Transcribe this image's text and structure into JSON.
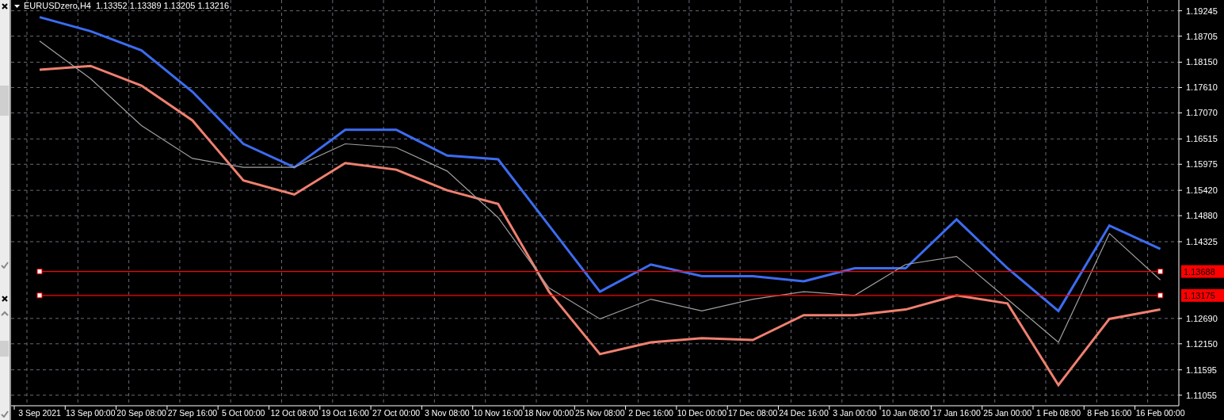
{
  "chart": {
    "ohlc": [
      "1.13352",
      "1.13389",
      "1.13205",
      "1.13216"
    ],
    "price_tags": [
      "1.13688",
      "1.13175"
    ],
    "chart_data": {
      "type": "line",
      "title": "EURUSDzero,H4",
      "grid": true,
      "categories": [
        "3 Sep 2021",
        "13 Sep 00:00",
        "20 Sep 08:00",
        "27 Sep 16:00",
        "5 Oct 00:00",
        "12 Oct 08:00",
        "19 Oct 16:00",
        "27 Oct 00:00",
        "3 Nov 08:00",
        "10 Nov 16:00",
        "18 Nov 00:00",
        "25 Nov 08:00",
        "2 Dec 16:00",
        "10 Dec 00:00",
        "17 Dec 08:00",
        "24 Dec 16:00",
        "3 Jan 00:00",
        "10 Jan 08:00",
        "17 Jan 16:00",
        "25 Jan 00:00",
        "1 Feb 08:00",
        "8 Feb 16:00",
        "16 Feb 00:00"
      ],
      "series": [
        {
          "color": "#3c6cf0",
          "values": [
            1.1911,
            1.1881,
            1.184,
            1.1752,
            1.1641,
            1.1591,
            1.1671,
            1.1671,
            1.1616,
            1.1608,
            1.1467,
            1.1326,
            1.1384,
            1.1359,
            1.1359,
            1.1348,
            1.1376,
            1.1376,
            1.148,
            1.1376,
            1.1285,
            1.1467,
            1.1417
          ]
        },
        {
          "color": "#f08070",
          "values": [
            1.1799,
            1.1807,
            1.1765,
            1.1691,
            1.1563,
            1.1533,
            1.16,
            1.1586,
            1.1542,
            1.1513,
            1.1326,
            1.1193,
            1.1218,
            1.1227,
            1.1223,
            1.1276,
            1.1276,
            1.1288,
            1.1318,
            1.1301,
            1.1127,
            1.1268,
            1.1288
          ]
        },
        {
          "color": "#a0a0a0",
          "values": [
            1.186,
            1.178,
            1.168,
            1.161,
            1.1591,
            1.1591,
            1.1641,
            1.1633,
            1.1583,
            1.1484,
            1.1334,
            1.1268,
            1.131,
            1.1285,
            1.131,
            1.1326,
            1.1318,
            1.1384,
            1.1401,
            1.131,
            1.1218,
            1.145,
            1.1351
          ]
        },
        {
          "color": "#ff0000",
          "values": [
            1.1369,
            1.1369,
            1.1369,
            1.1369,
            1.1369,
            1.1369,
            1.1369,
            1.1369,
            1.1369,
            1.1369,
            1.1369,
            1.1369,
            1.1369,
            1.1369,
            1.1369,
            1.1369,
            1.1369,
            1.1369,
            1.1369,
            1.1369,
            1.1369,
            1.1369,
            1.1369
          ]
        },
        {
          "color": "#ff0000",
          "values": [
            1.1318,
            1.1318,
            1.1318,
            1.1318,
            1.1318,
            1.1318,
            1.1318,
            1.1318,
            1.1318,
            1.1318,
            1.1318,
            1.1318,
            1.1318,
            1.1318,
            1.1318,
            1.1318,
            1.1318,
            1.1318,
            1.1318,
            1.1318,
            1.1318,
            1.1318,
            1.1318
          ]
        }
      ],
      "ylim": [
        1.1083,
        1.19475
      ],
      "yticks": [
        {
          "value": 1.19245,
          "label": "1.19245"
        },
        {
          "value": 1.18705,
          "label": "1.18705"
        },
        {
          "value": 1.1815,
          "label": "1.18150"
        },
        {
          "value": 1.1761,
          "label": "1.17610"
        },
        {
          "value": 1.1707,
          "label": "1.17070"
        },
        {
          "value": 1.16515,
          "label": "1.16515"
        },
        {
          "value": 1.15975,
          "label": "1.15975"
        },
        {
          "value": 1.1542,
          "label": "1.15420"
        },
        {
          "value": 1.1488,
          "label": "1.14880"
        },
        {
          "value": 1.14325,
          "label": "1.14325"
        },
        {
          "value": 1.1269,
          "label": "1.12690"
        },
        {
          "value": 1.1215,
          "label": "1.12150"
        },
        {
          "value": 1.11595,
          "label": "1.11595"
        },
        {
          "value": 1.11055,
          "label": "1.11055"
        }
      ]
    }
  }
}
